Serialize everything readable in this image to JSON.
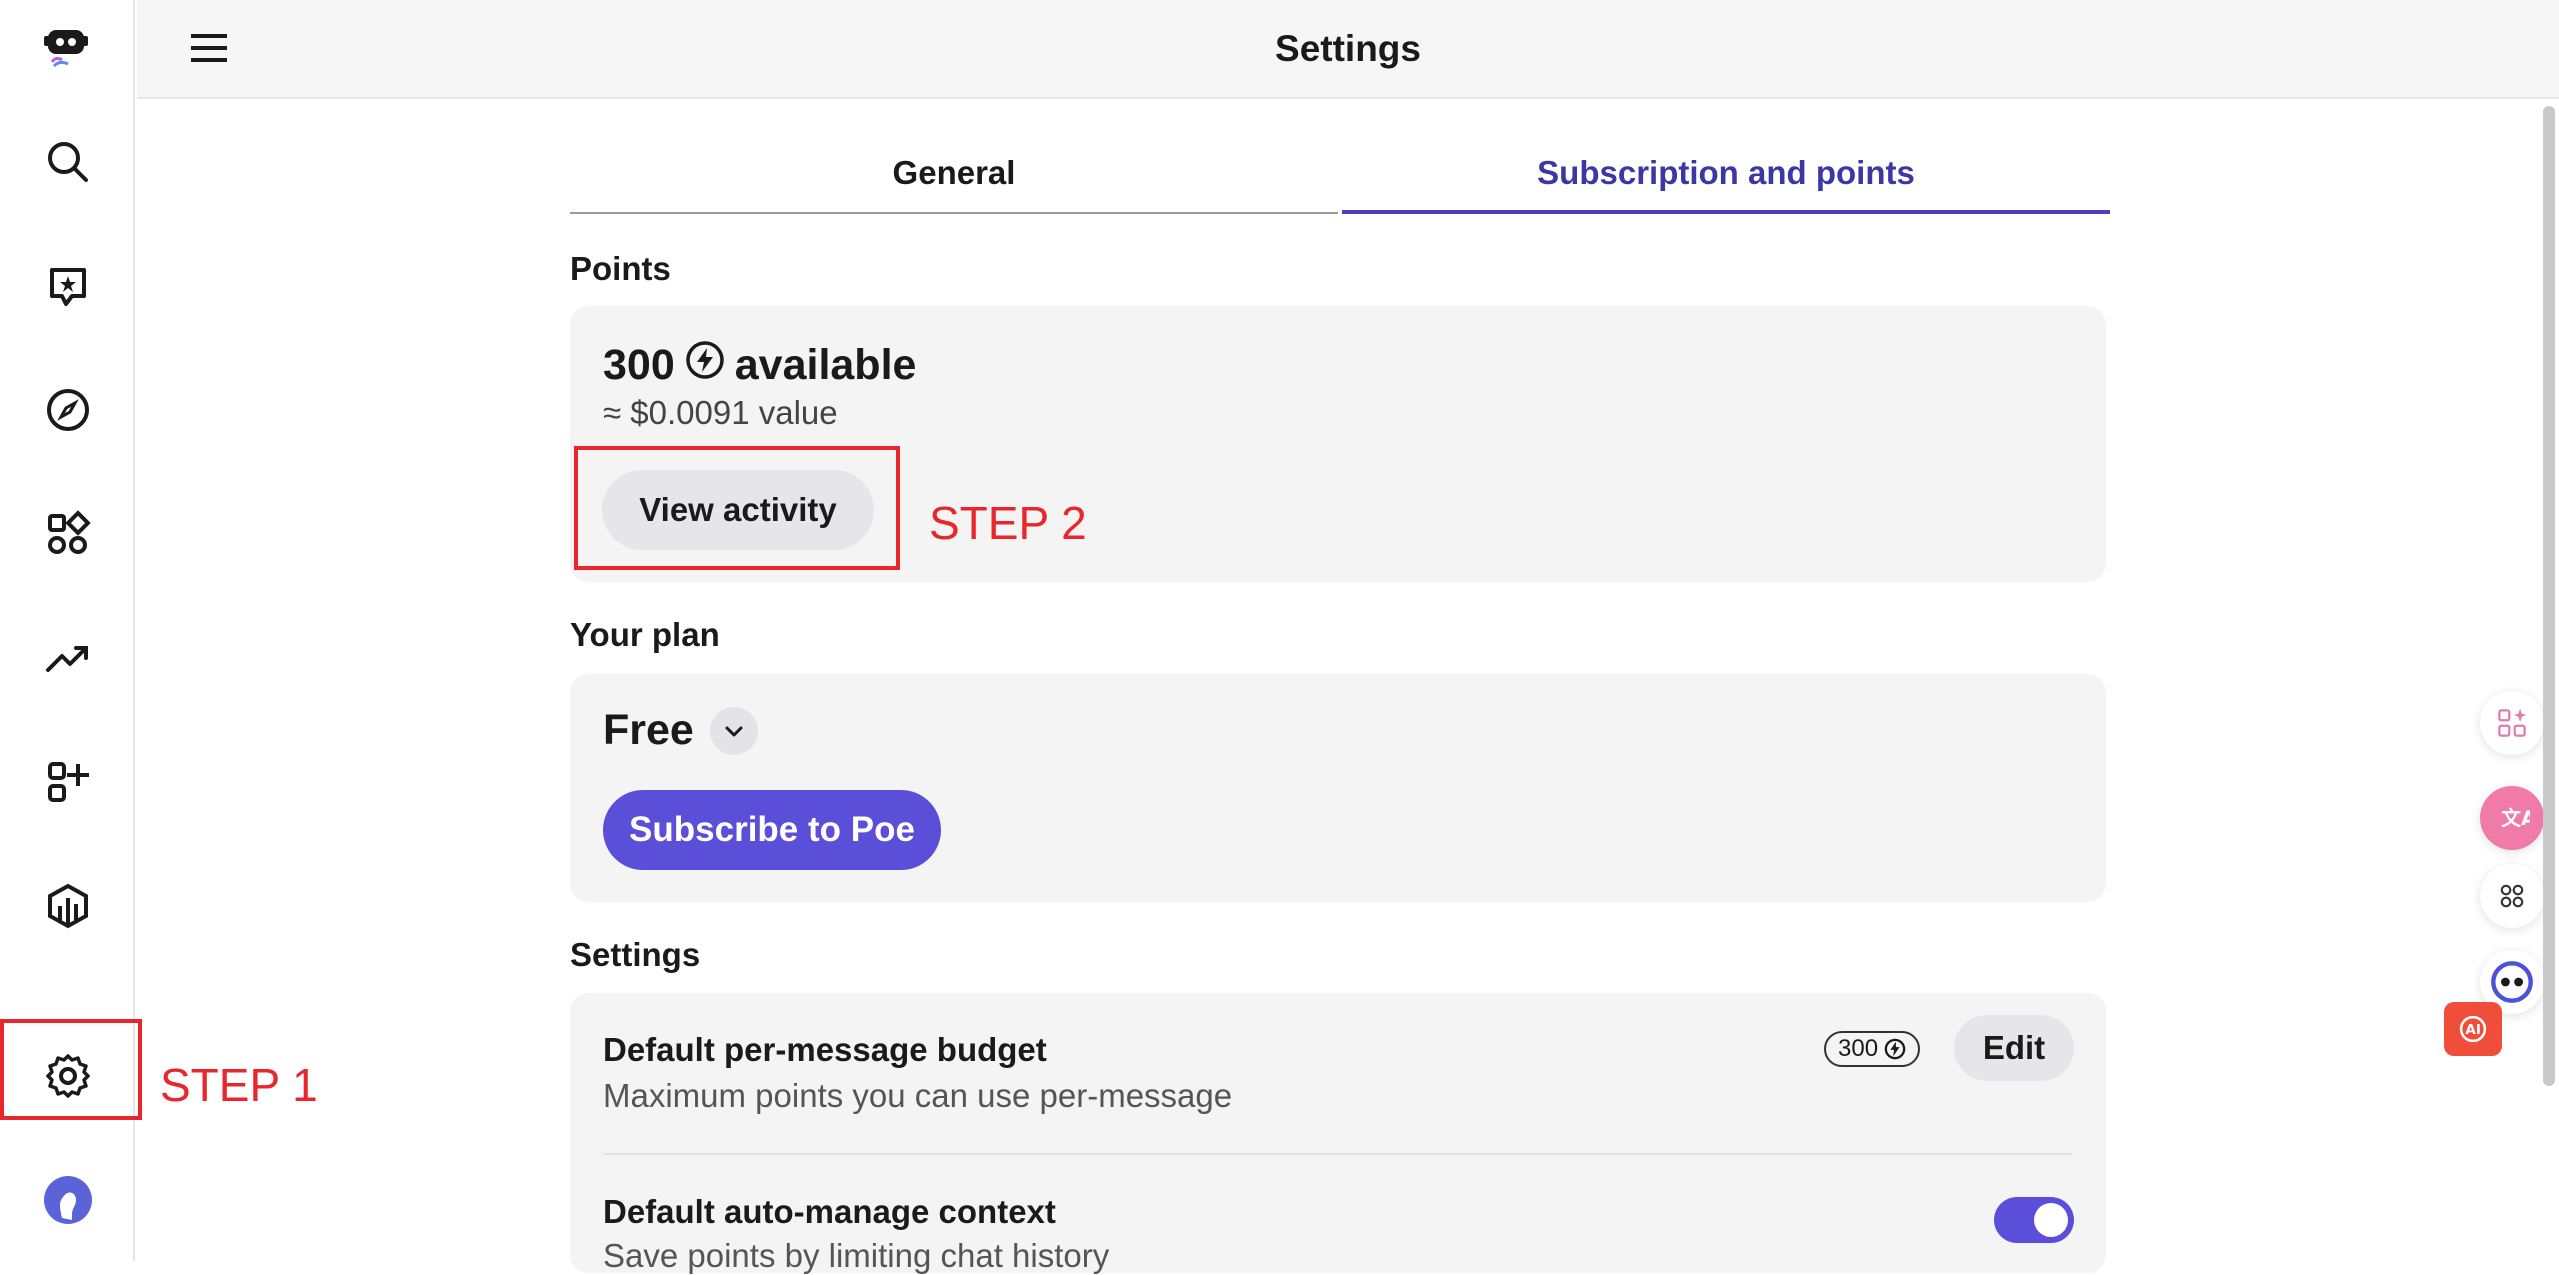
{
  "header": {
    "title": "Settings"
  },
  "tabs": [
    {
      "label": "General"
    },
    {
      "label": "Subscription and points"
    }
  ],
  "points": {
    "section_label": "Points",
    "amount": "300",
    "available_label": "available",
    "value_text": "≈ $0.0091 value",
    "view_activity_label": "View activity"
  },
  "plan": {
    "section_label": "Your plan",
    "name": "Free",
    "subscribe_label": "Subscribe to Poe"
  },
  "settings": {
    "section_label": "Settings",
    "budget": {
      "title": "Default per-message budget",
      "desc": "Maximum points you can use per-message",
      "badge_value": "300",
      "edit_label": "Edit"
    },
    "auto_context": {
      "title": "Default auto-manage context",
      "desc": "Save points by limiting chat history",
      "enabled": true
    }
  },
  "annotations": {
    "step1": "STEP 1",
    "step2": "STEP 2"
  },
  "colors": {
    "accent": "#5b4ed9",
    "tab_active": "#3d37a6",
    "annotation": "#e8262b"
  }
}
